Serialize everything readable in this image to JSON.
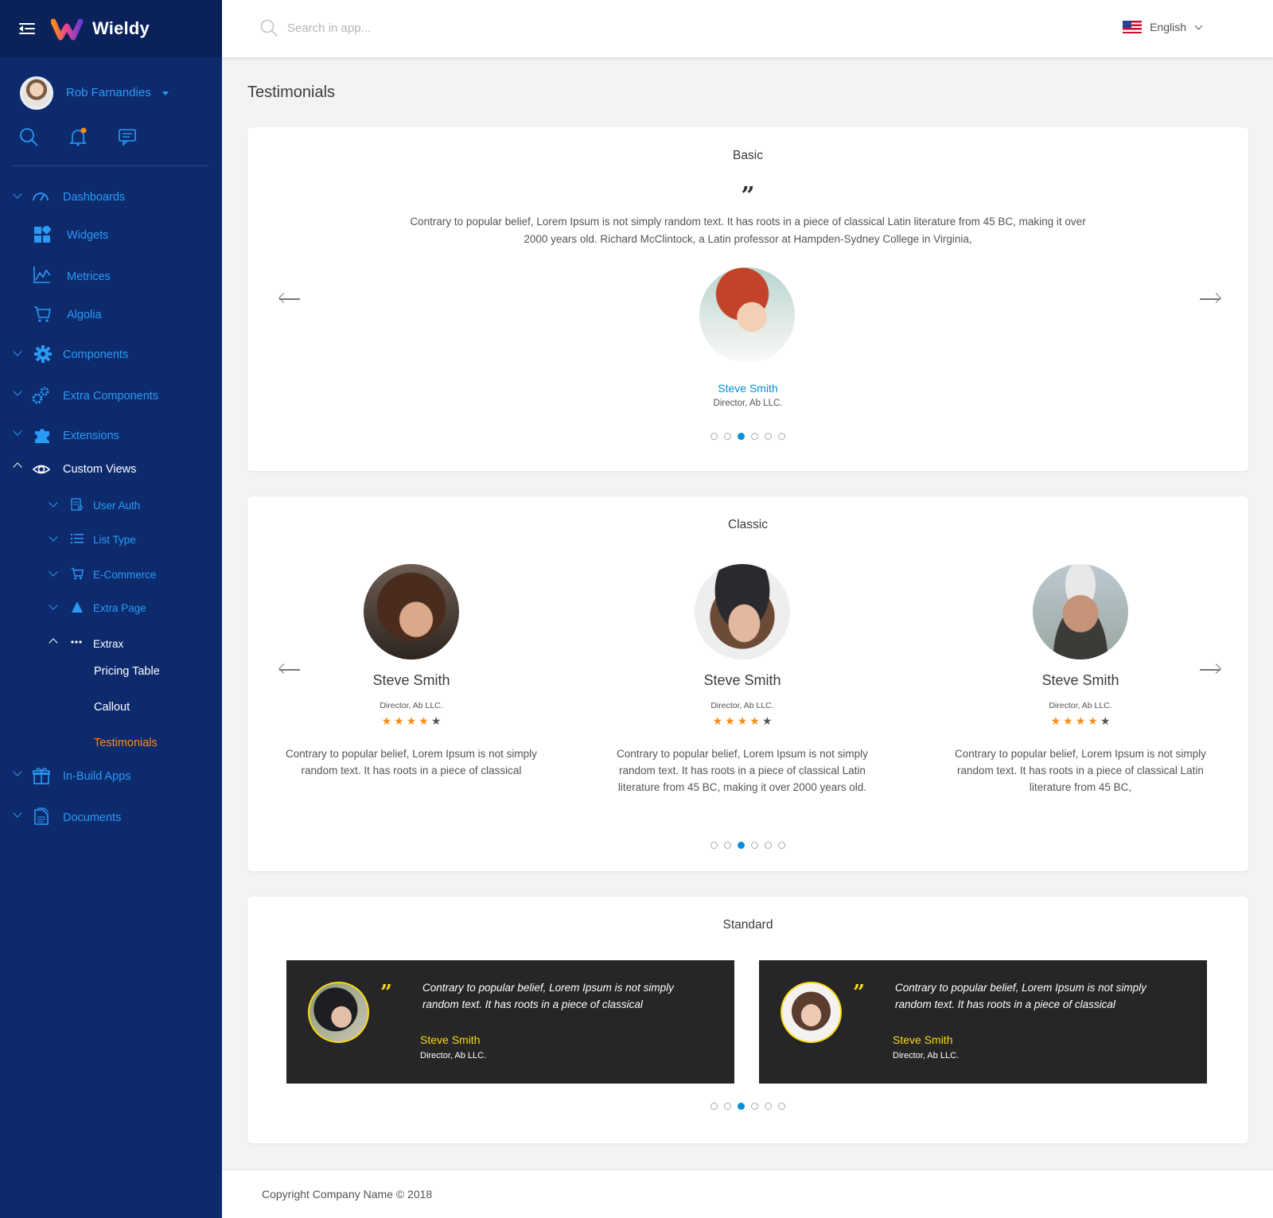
{
  "app": {
    "name": "Wieldy"
  },
  "user": {
    "name": "Rob Farnandies"
  },
  "search": {
    "placeholder": "Search in app..."
  },
  "language": {
    "label": "English"
  },
  "sidebar": {
    "items": [
      {
        "label": "Dashboards",
        "icon": "dashboard-icon"
      },
      {
        "label": "Widgets",
        "icon": "widgets-icon"
      },
      {
        "label": "Metrices",
        "icon": "chart-icon"
      },
      {
        "label": "Algolia",
        "icon": "cart-icon"
      },
      {
        "label": "Components",
        "icon": "gear-icon"
      },
      {
        "label": "Extra Components",
        "icon": "gears-icon"
      },
      {
        "label": "Extensions",
        "icon": "puzzle-icon"
      },
      {
        "label": "Custom Views",
        "icon": "eye-icon"
      },
      {
        "label": "User Auth",
        "icon": "auth-icon"
      },
      {
        "label": "List Type",
        "icon": "list-icon"
      },
      {
        "label": "E-Commerce",
        "icon": "cart-icon"
      },
      {
        "label": "Extra Page",
        "icon": "triangle-icon"
      },
      {
        "label": "Extrax",
        "icon": "ellipsis-icon"
      },
      {
        "label": "Pricing Table"
      },
      {
        "label": "Callout"
      },
      {
        "label": "Testimonials"
      },
      {
        "label": "In-Build Apps",
        "icon": "gift-icon"
      },
      {
        "label": "Documents",
        "icon": "document-icon"
      }
    ]
  },
  "page": {
    "title": "Testimonials"
  },
  "basic": {
    "title": "Basic",
    "quote": "”",
    "text": "Contrary to popular belief, Lorem Ipsum is not simply random text. It has roots in a piece of classical Latin literature from 45 BC, making it over 2000 years old. Richard McClintock, a Latin professor at Hampden-Sydney College in Virginia,",
    "name": "Steve Smith",
    "role": "Director, Ab LLC."
  },
  "classic": {
    "title": "Classic",
    "items": [
      {
        "name": "Steve Smith",
        "role": "Director, Ab LLC.",
        "rating": 4,
        "text": "Contrary to popular belief, Lorem Ipsum is not simply random text. It has roots in a piece of classical"
      },
      {
        "name": "Steve Smith",
        "role": "Director, Ab LLC.",
        "rating": 4,
        "text": "Contrary to popular belief, Lorem Ipsum is not simply random text. It has roots in a piece of classical Latin literature from 45 BC, making it over 2000 years old."
      },
      {
        "name": "Steve Smith",
        "role": "Director, Ab LLC.",
        "rating": 4,
        "text": "Contrary to popular belief, Lorem Ipsum is not simply random text. It has roots in a piece of classical Latin literature from 45 BC,"
      }
    ]
  },
  "standard": {
    "title": "Standard",
    "items": [
      {
        "name": "Steve Smith",
        "role": "Director, Ab LLC.",
        "text": "Contrary to popular belief, Lorem Ipsum is not simply random text. It has roots in a piece of classical"
      },
      {
        "name": "Steve Smith",
        "role": "Director, Ab LLC.",
        "text": "Contrary to popular belief, Lorem Ipsum is not simply random text. It has roots in a piece of classical"
      }
    ]
  },
  "carousel": {
    "active_index": 2
  },
  "footer": {
    "text": "Copyright Company Name © 2018"
  },
  "colors": {
    "sidebar": "#0d2a6d",
    "accent": "#038fde",
    "active": "#fa8c16",
    "star": "#fa8c16",
    "standard_bg": "#262626",
    "standard_accent": "#fadb14"
  }
}
